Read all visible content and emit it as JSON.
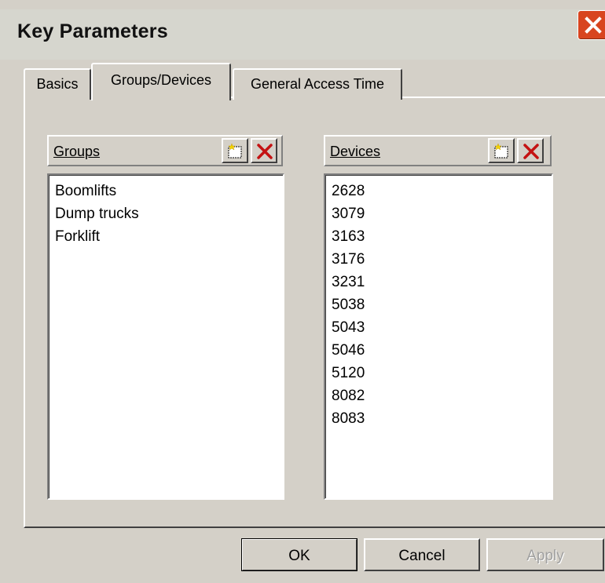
{
  "window": {
    "title": "Key Parameters"
  },
  "tabs": [
    {
      "label": "Basics",
      "selected": false
    },
    {
      "label": "Groups/Devices",
      "selected": true
    },
    {
      "label": "General Access Time",
      "selected": false
    }
  ],
  "groups": {
    "header": "Groups",
    "items": [
      "Boomlifts",
      "Dump trucks",
      "Forklift"
    ]
  },
  "devices": {
    "header": "Devices",
    "items": [
      "2628",
      "3079",
      "3163",
      "3176",
      "3231",
      "5038",
      "5043",
      "5046",
      "5120",
      "8082",
      "8083"
    ]
  },
  "buttons": {
    "ok": "OK",
    "cancel": "Cancel",
    "apply": "Apply",
    "apply_enabled": false
  },
  "icons": {
    "close": "close-icon",
    "new": "new-item-icon",
    "delete": "delete-x-icon"
  },
  "colors": {
    "face": "#d4d0c8",
    "close_button": "#d8451f",
    "delete_red": "#c41212"
  }
}
